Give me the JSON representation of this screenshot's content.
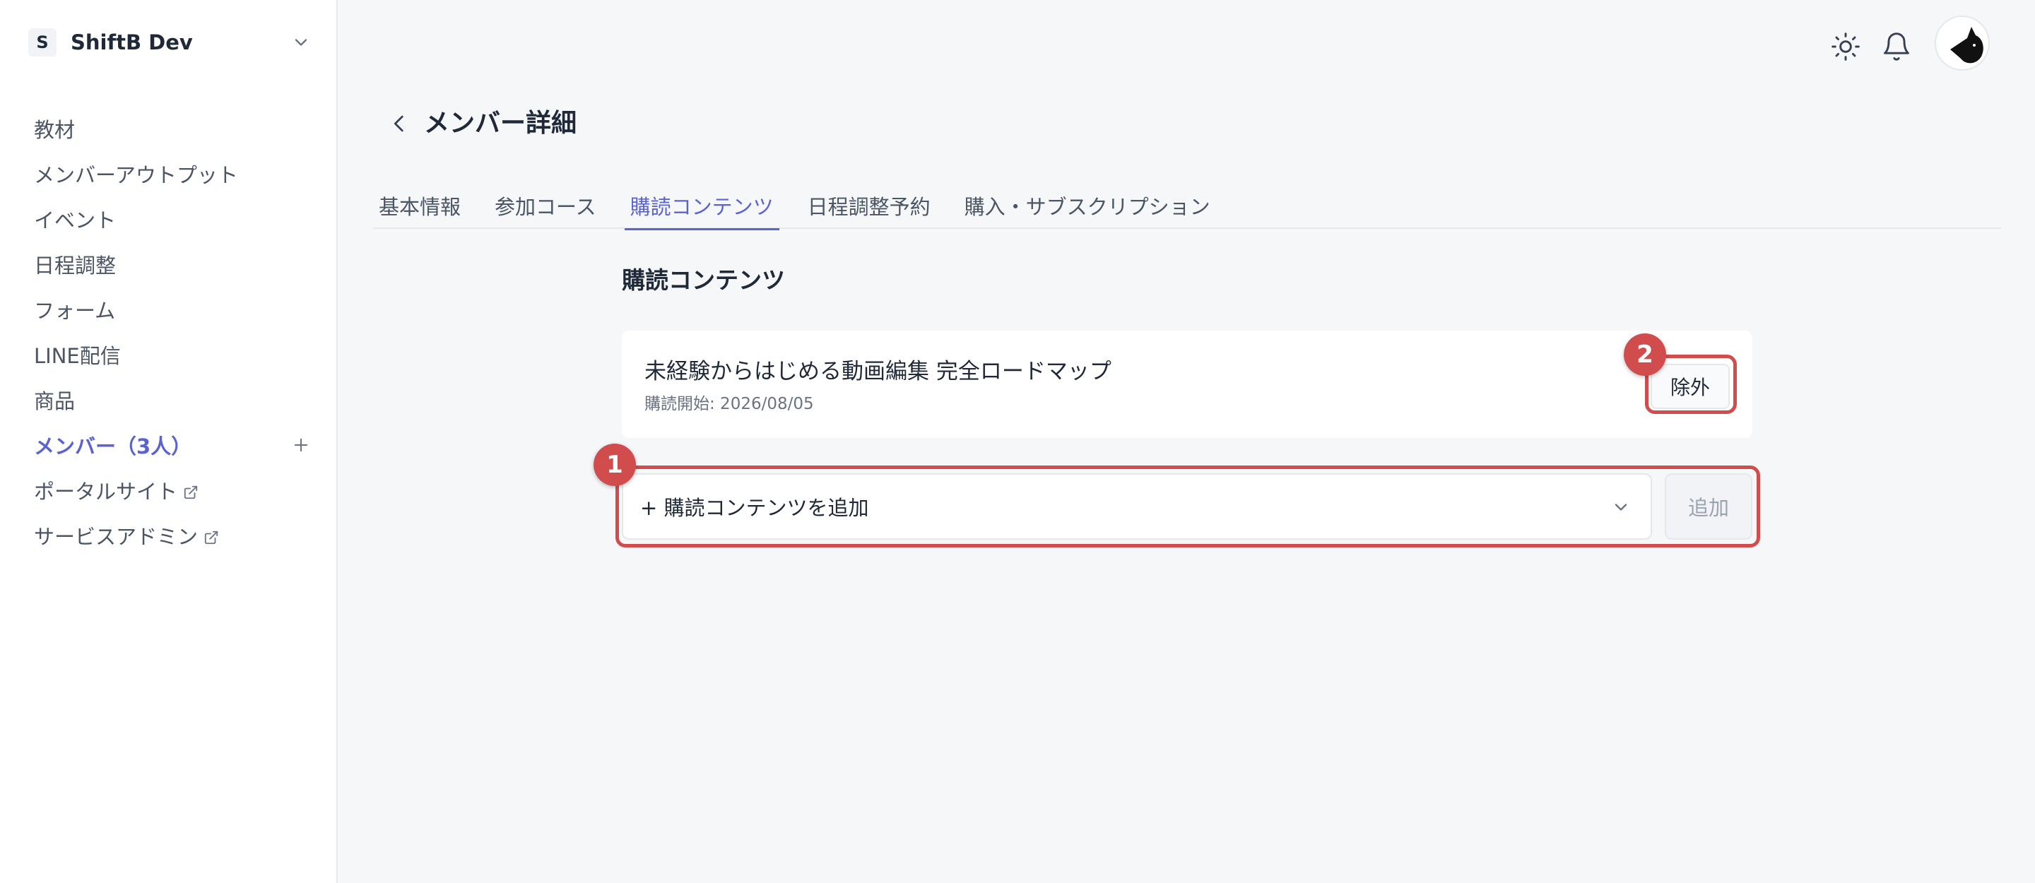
{
  "workspace": {
    "initial": "S",
    "name": "ShiftB Dev"
  },
  "sidebar": {
    "items": [
      {
        "label": "教材"
      },
      {
        "label": "メンバーアウトプット"
      },
      {
        "label": "イベント"
      },
      {
        "label": "日程調整"
      },
      {
        "label": "フォーム"
      },
      {
        "label": "LINE配信"
      },
      {
        "label": "商品"
      },
      {
        "label": "メンバー（3人）"
      },
      {
        "label": "ポータルサイト"
      },
      {
        "label": "サービスアドミン"
      }
    ]
  },
  "header": {
    "icons": [
      "sun-icon",
      "bell-icon",
      "avatar"
    ]
  },
  "page": {
    "title": "メンバー詳細",
    "tabs": [
      {
        "label": "基本情報"
      },
      {
        "label": "参加コース"
      },
      {
        "label": "購読コンテンツ"
      },
      {
        "label": "日程調整予約"
      },
      {
        "label": "購入・サブスクリプション"
      }
    ],
    "active_tab": "購読コンテンツ"
  },
  "content": {
    "section_title": "購読コンテンツ",
    "subscription": {
      "title": "未経験からはじめる動画編集 完全ロードマップ",
      "start_date": "購読開始: 2026/08/05",
      "exclude_label": "除外"
    },
    "add_select_placeholder": "+ 購読コンテンツを追加",
    "add_label": "追加"
  },
  "annotations": [
    {
      "label": "1"
    },
    {
      "label": "2"
    }
  ],
  "colors": {
    "accent": "#5b63d3",
    "annotation": "#d14d4d",
    "background": "#f6f7f9"
  }
}
